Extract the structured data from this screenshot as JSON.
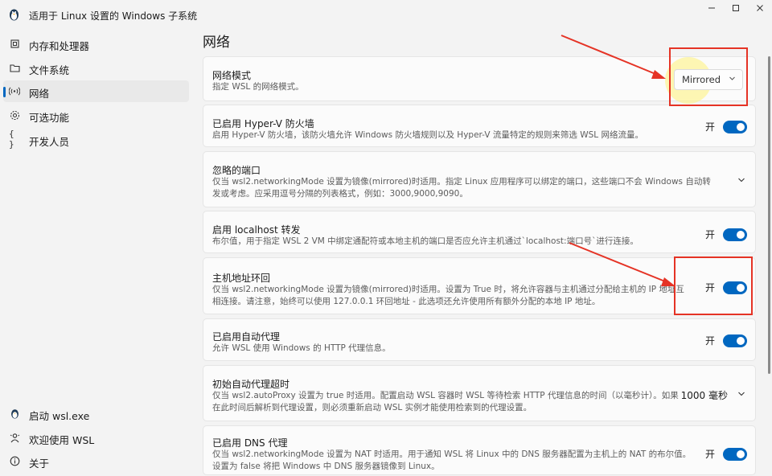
{
  "window": {
    "title": "适用于 Linux 设置的 Windows 子系统",
    "icon": "penguin-icon"
  },
  "sidebar": {
    "items": [
      {
        "label": "内存和处理器",
        "icon": "memory-icon"
      },
      {
        "label": "文件系统",
        "icon": "folder-icon"
      },
      {
        "label": "网络",
        "icon": "network-icon",
        "active": true
      },
      {
        "label": "可选功能",
        "icon": "gear-icon"
      },
      {
        "label": "开发人员",
        "icon": "braces-icon"
      }
    ],
    "bottom_items": [
      {
        "label": "启动 wsl.exe",
        "icon": "penguin-icon"
      },
      {
        "label": "欢迎使用 WSL",
        "icon": "welcome-icon"
      },
      {
        "label": "关于",
        "icon": "info-icon"
      }
    ]
  },
  "main": {
    "title": "网络",
    "settings": [
      {
        "title": "网络模式",
        "desc": "指定 WSL 的网络模式。",
        "control": "dropdown",
        "value": "Mirrored"
      },
      {
        "title": "已启用 Hyper-V 防火墙",
        "desc": "启用 Hyper-V 防火墙，该防火墙允许 Windows 防火墙规则以及 Hyper-V 流量特定的规则来筛选 WSL 网络流量。",
        "control": "toggle",
        "state": "开"
      },
      {
        "title": "忽略的端口",
        "desc": "仅当 wsl2.networkingMode 设置为镜像(mirrored)时适用。指定 Linux 应用程序可以绑定的端口，这些端口不会 Windows 自动转发或考虑。应采用逗号分隔的列表格式，例如：3000,9000,9090。",
        "control": "expand"
      },
      {
        "title": "启用 localhost 转发",
        "desc": "布尔值，用于指定 WSL 2 VM 中绑定通配符或本地主机的端口是否应允许主机通过`localhost:端口号`进行连接。",
        "control": "toggle",
        "state": "开"
      },
      {
        "title": "主机地址环回",
        "desc": "仅当 wsl2.networkingMode 设置为镜像(mirrored)时适用。设置为 True 时，将允许容器与主机通过分配给主机的 IP 地址互相连接。请注意，始终可以使用 127.0.0.1 环回地址 - 此选项还允许使用所有额外分配的本地 IP 地址。",
        "control": "toggle",
        "state": "开"
      },
      {
        "title": "已启用自动代理",
        "desc": "允许 WSL 使用 Windows 的 HTTP 代理信息。",
        "control": "toggle",
        "state": "开"
      },
      {
        "title": "初始自动代理超时",
        "desc": "仅当 wsl2.autoProxy 设置为 true 时适用。配置启动 WSL 容器时 WSL 等待检索 HTTP 代理信息的时间（以毫秒计）。如果在此时间后解析到代理设置，则必须重新启动 WSL 实例才能使用检索到的代理设置。",
        "control": "value",
        "value": "1000 毫秒"
      },
      {
        "title": "已启用 DNS 代理",
        "desc": "仅当 wsl2.networkingMode 设置为 NAT 时适用。用于通知 WSL 将 Linux 中的 DNS 服务器配置为主机上的 NAT 的布尔值。设置为 false 将把 Windows 中 DNS 服务器镜像到 Linux。",
        "control": "toggle",
        "state": "开"
      }
    ]
  },
  "colors": {
    "accent": "#0067c0",
    "annotation": "#e53325"
  }
}
